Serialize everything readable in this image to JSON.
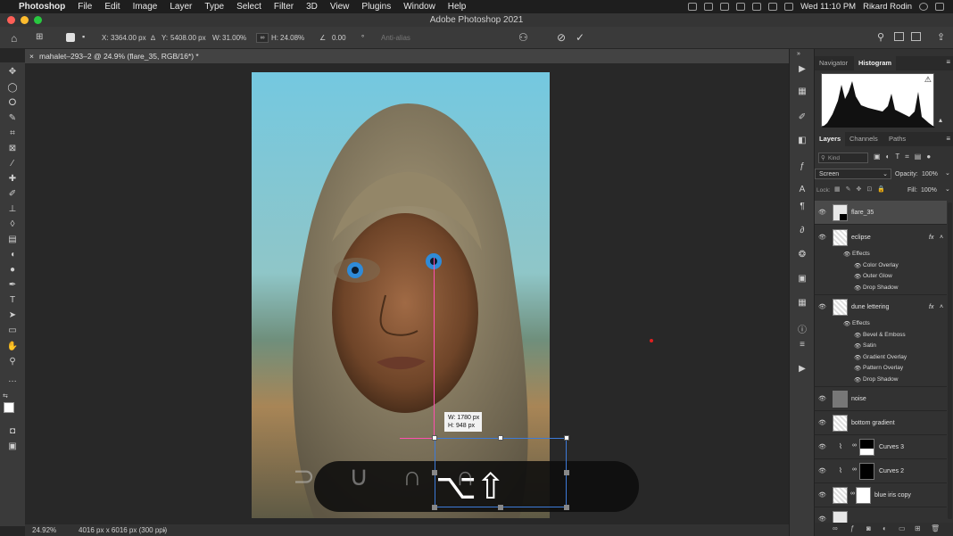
{
  "menubar": {
    "apple": "",
    "app": "Photoshop",
    "items": [
      "File",
      "Edit",
      "Image",
      "Layer",
      "Type",
      "Select",
      "Filter",
      "3D",
      "View",
      "Plugins",
      "Window",
      "Help"
    ],
    "datetime": "Wed 11:10 PM",
    "user": "Rikard Rodin"
  },
  "window": {
    "title": "Adobe Photoshop 2021"
  },
  "options": {
    "x_label": "X:",
    "x": "3364.00 px",
    "y_label": "Y:",
    "y": "5408.00 px",
    "w_label": "W:",
    "w": "31.00%",
    "h_label": "H:",
    "h": "24.08%",
    "angle": "0.00",
    "angle_unit": "°",
    "antialias": "Anti-alias"
  },
  "document": {
    "tab": "mahalet–293–2 @ 24.9% (flare_35, RGB/16*) *",
    "zoom": "24.92%",
    "info": "4016 px x 6016 px (300 ppi)"
  },
  "transform_tooltip": {
    "w": "W: 1780 px",
    "h": "H:  948 px"
  },
  "panels": {
    "top_tabs": [
      "Navigator",
      "Histogram"
    ],
    "layer_tabs": [
      "Layers",
      "Channels",
      "Paths"
    ],
    "kind": "Kind",
    "blend_mode": "Screen",
    "opacity_label": "Opacity:",
    "opacity": "100%",
    "lock_label": "Lock:",
    "fill_label": "Fill:",
    "fill": "100%",
    "effects_label": "Effects",
    "fx": "fx",
    "layers": [
      {
        "name": "flare_35"
      },
      {
        "name": "eclipse",
        "effects": [
          "Color Overlay",
          "Outer Glow",
          "Drop Shadow"
        ]
      },
      {
        "name": "dune lettering",
        "effects": [
          "Bevel & Emboss",
          "Satin",
          "Gradient Overlay",
          "Pattern Overlay",
          "Drop Shadow"
        ]
      },
      {
        "name": "noise"
      },
      {
        "name": "bottom gradient"
      },
      {
        "name": "Curves 3"
      },
      {
        "name": "Curves 2"
      },
      {
        "name": "blue iris copy"
      }
    ]
  },
  "colors": {
    "accent": "#2d6bd6",
    "menubar": "#1e1e1e",
    "panel": "#323232",
    "guide": "#ff4fb0"
  }
}
